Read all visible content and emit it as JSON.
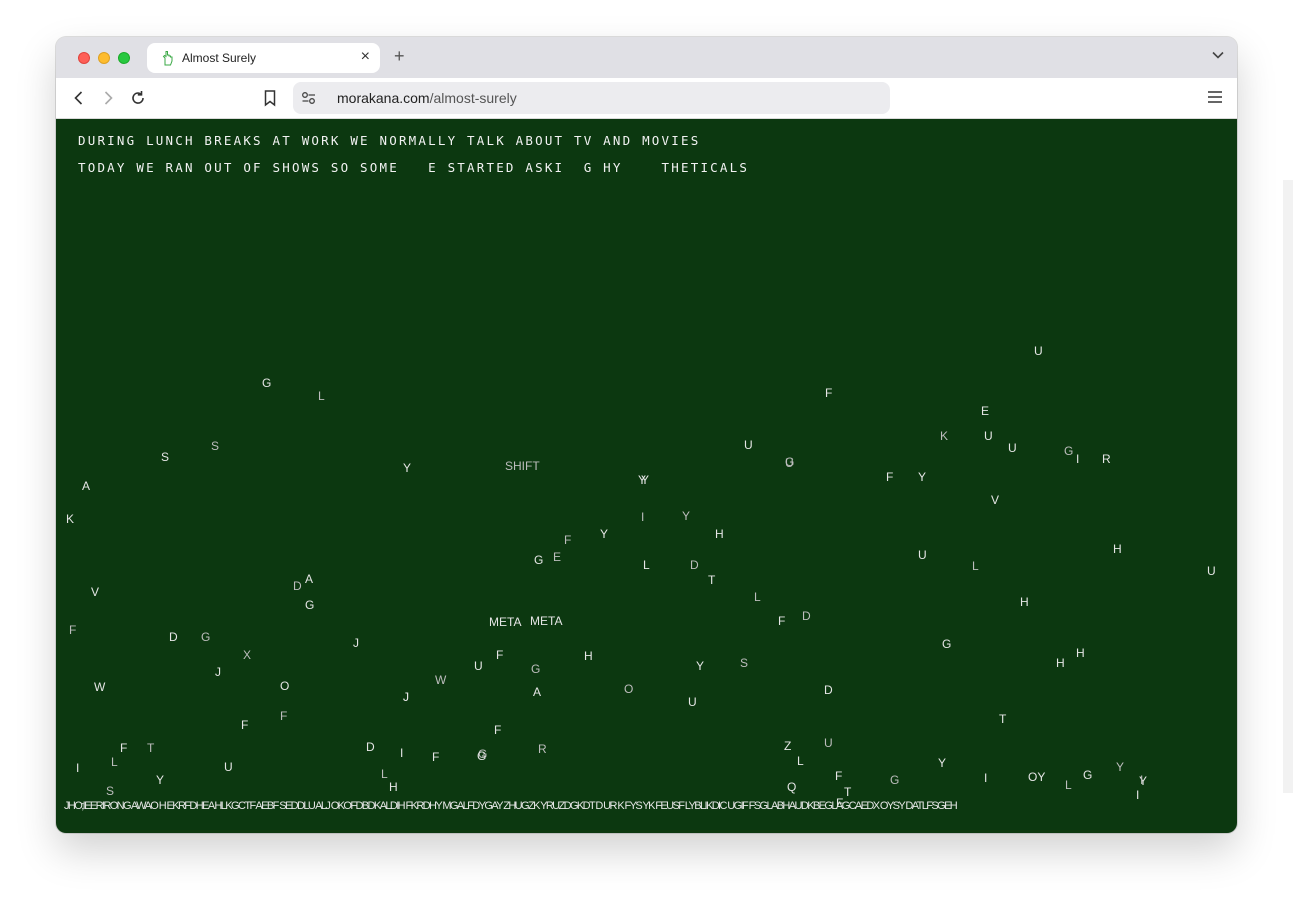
{
  "browser": {
    "tab_title": "Almost Surely",
    "new_tab_symbol": "+",
    "close_symbol": "×",
    "url_host": "morakana.com",
    "url_path": "/almost-surely"
  },
  "page": {
    "line1": "DURING LUNCH BREAKS AT WORK WE NORMALLY TALK ABOUT TV AND MOVIES",
    "line2": "TODAY WE RAN OUT OF SHOWS SO SOME   E STARTED ASKI  G HY    THETICALS",
    "bottom_row": "JHO;IEERIRONG AWAO H EKRFDHEA HLKGCTF AEBF SEDDLU ALJ OKOFDBDKALDIH FKRDHY MGALFDYGAY ZHUGZK YRUZDGKDT D UR K FYS YK FEUSF LYBLIKDIC UGIF FSGLABHAUDKBEGLAGCAEDX OYSY DATLFSGEH",
    "floating_letters": [
      {
        "t": "G"
      },
      {
        "t": "L"
      },
      {
        "t": "U"
      },
      {
        "t": "E"
      },
      {
        "t": "K"
      },
      {
        "t": "U"
      },
      {
        "t": "U"
      },
      {
        "t": "G"
      },
      {
        "t": "I"
      },
      {
        "t": "R"
      },
      {
        "t": "S"
      },
      {
        "t": "Y"
      },
      {
        "t": "S"
      },
      {
        "t": "SHIFT"
      },
      {
        "t": "U"
      },
      {
        "t": "F"
      },
      {
        "t": "G"
      },
      {
        "t": "F"
      },
      {
        "t": "Y"
      },
      {
        "t": "U"
      },
      {
        "t": "A"
      },
      {
        "t": "Y"
      },
      {
        "t": "Y"
      },
      {
        "t": "V"
      },
      {
        "t": "K"
      },
      {
        "t": "I"
      },
      {
        "t": "Y"
      },
      {
        "t": "H"
      },
      {
        "t": "F"
      },
      {
        "t": "Y"
      },
      {
        "t": "G"
      },
      {
        "t": "E"
      },
      {
        "t": "H"
      },
      {
        "t": "L"
      },
      {
        "t": "D"
      },
      {
        "t": "T"
      },
      {
        "t": "U"
      },
      {
        "t": "L"
      },
      {
        "t": "U"
      },
      {
        "t": "A"
      },
      {
        "t": "D"
      },
      {
        "t": "V"
      },
      {
        "t": "G"
      },
      {
        "t": "L"
      },
      {
        "t": "H"
      },
      {
        "t": "F"
      },
      {
        "t": "D"
      },
      {
        "t": "META"
      },
      {
        "t": "META"
      },
      {
        "t": "F"
      },
      {
        "t": "J"
      },
      {
        "t": "D"
      },
      {
        "t": "G"
      },
      {
        "t": "J"
      },
      {
        "t": "G"
      },
      {
        "t": "X"
      },
      {
        "t": "F"
      },
      {
        "t": "U"
      },
      {
        "t": "G"
      },
      {
        "t": "H"
      },
      {
        "t": "Y"
      },
      {
        "t": "S"
      },
      {
        "t": "H"
      },
      {
        "t": "H"
      },
      {
        "t": "J"
      },
      {
        "t": "W"
      },
      {
        "t": "O"
      },
      {
        "t": "W"
      },
      {
        "t": "J"
      },
      {
        "t": "A"
      },
      {
        "t": "O"
      },
      {
        "t": "U"
      },
      {
        "t": "D"
      },
      {
        "t": "F"
      },
      {
        "t": "F"
      },
      {
        "t": "F"
      },
      {
        "t": "G"
      },
      {
        "t": "T"
      },
      {
        "t": "F"
      },
      {
        "t": "T"
      },
      {
        "t": "D"
      },
      {
        "t": "I"
      },
      {
        "t": "R"
      },
      {
        "t": "Z"
      },
      {
        "t": "L"
      },
      {
        "t": "U"
      },
      {
        "t": "F"
      },
      {
        "t": "G"
      },
      {
        "t": "L"
      },
      {
        "t": "Y"
      },
      {
        "t": "I"
      },
      {
        "t": "L"
      },
      {
        "t": "U"
      },
      {
        "t": "F"
      },
      {
        "t": "G"
      },
      {
        "t": "Y"
      },
      {
        "t": "H"
      },
      {
        "t": "Y"
      },
      {
        "t": "I"
      },
      {
        "t": "OY"
      },
      {
        "t": "L"
      },
      {
        "t": "G"
      },
      {
        "t": "Y"
      },
      {
        "t": "I"
      },
      {
        "t": "Q"
      },
      {
        "t": "T"
      },
      {
        "t": "S"
      },
      {
        "t": "F"
      },
      {
        "t": "I"
      }
    ]
  },
  "colors": {
    "page_bg": "#0c3810",
    "text": "#f2f2f2"
  }
}
